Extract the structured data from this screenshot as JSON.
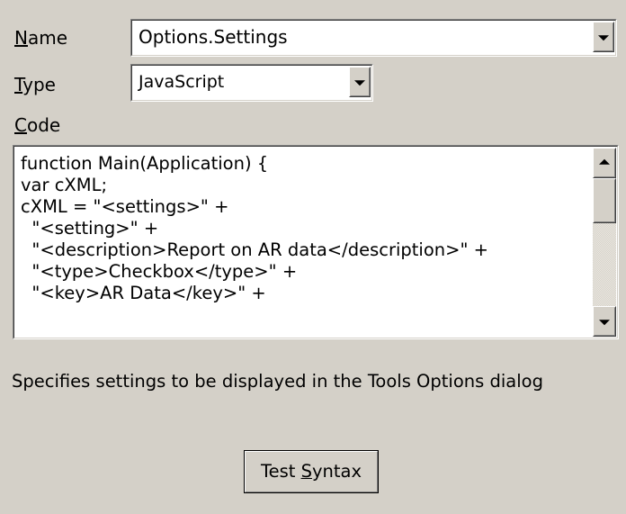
{
  "name_field": {
    "label_underlined": "N",
    "label_rest": "ame",
    "value": "Options.Settings"
  },
  "type_field": {
    "label_underlined": "T",
    "label_rest": "ype",
    "value": "JavaScript"
  },
  "code_field": {
    "label_underlined": "C",
    "label_rest": "ode",
    "lines": [
      "function Main(Application) {",
      "var cXML;",
      "cXML = \"<settings>\" +",
      "  \"<setting>\" +",
      "  \"<description>Report on AR data</description>\" +",
      "  \"<type>Checkbox</type>\" +",
      "  \"<key>AR Data</key>\" +"
    ]
  },
  "description_text": "Specifies settings to be displayed in the Tools Options dialog",
  "test_button": {
    "label_before": "Test ",
    "label_underlined": "S",
    "label_after": "yntax"
  },
  "icons": {
    "dropdown": "chevron-down-icon",
    "scroll_up": "arrow-up-icon",
    "scroll_down": "arrow-down-icon"
  }
}
